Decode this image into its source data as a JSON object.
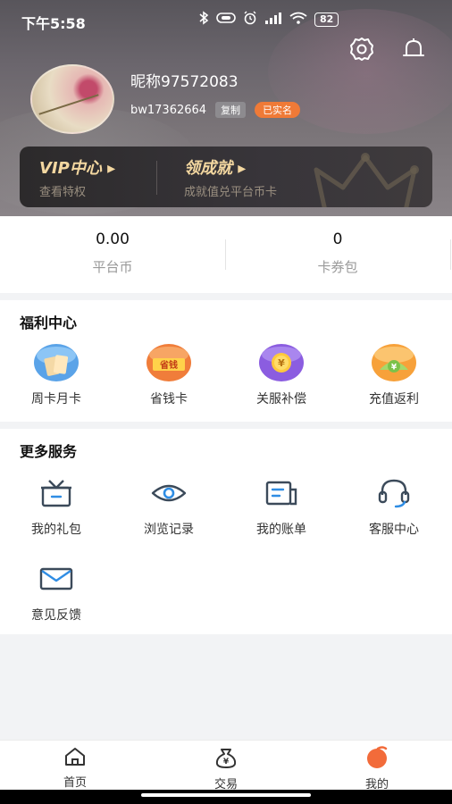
{
  "status_bar": {
    "time": "下午5:58",
    "battery": "82",
    "icons": [
      "bluetooth-icon",
      "nfc-icon",
      "alarm-icon",
      "signal-icon",
      "wifi-icon",
      "battery-icon"
    ]
  },
  "header": {
    "settings_icon": "gear-icon",
    "notification_icon": "bell-icon"
  },
  "profile": {
    "nickname": "昵称97572083",
    "user_id": "bw17362664",
    "copy_label": "复制",
    "verified_label": "已实名"
  },
  "vip_card": {
    "vip_title": "VIP中心",
    "vip_subtitle": "查看特权",
    "achievement_title": "领成就",
    "achievement_subtitle": "成就值兑平台币卡"
  },
  "wallet": {
    "items": [
      {
        "value": "0.00",
        "label": "平台币"
      },
      {
        "value": "0",
        "label": "卡券包"
      }
    ]
  },
  "welfare": {
    "title": "福利中心",
    "items": [
      {
        "label": "周卡月卡",
        "icon": "weekly-monthly-card-icon"
      },
      {
        "label": "省钱卡",
        "icon": "money-saving-card-icon",
        "badge": "省钱"
      },
      {
        "label": "关服补偿",
        "icon": "server-closure-compensation-icon",
        "badge": "¥"
      },
      {
        "label": "充值返利",
        "icon": "recharge-rebate-icon",
        "badge": "¥"
      }
    ]
  },
  "services": {
    "title": "更多服务",
    "items": [
      {
        "label": "我的礼包",
        "icon": "gift-box-icon"
      },
      {
        "label": "浏览记录",
        "icon": "eye-icon"
      },
      {
        "label": "我的账单",
        "icon": "bill-icon"
      },
      {
        "label": "客服中心",
        "icon": "headset-icon"
      },
      {
        "label": "意见反馈",
        "icon": "mail-icon"
      }
    ]
  },
  "bottom_nav": {
    "items": [
      {
        "label": "首页",
        "icon": "home-icon"
      },
      {
        "label": "交易",
        "icon": "money-bag-icon",
        "badge": "¥"
      },
      {
        "label": "我的",
        "icon": "profile-icon"
      }
    ],
    "active_index": 2
  },
  "colors": {
    "accent_orange": "#ef7a37",
    "vip_gold": "#f3d7a0",
    "icon_slate": "#3b4a5a"
  }
}
